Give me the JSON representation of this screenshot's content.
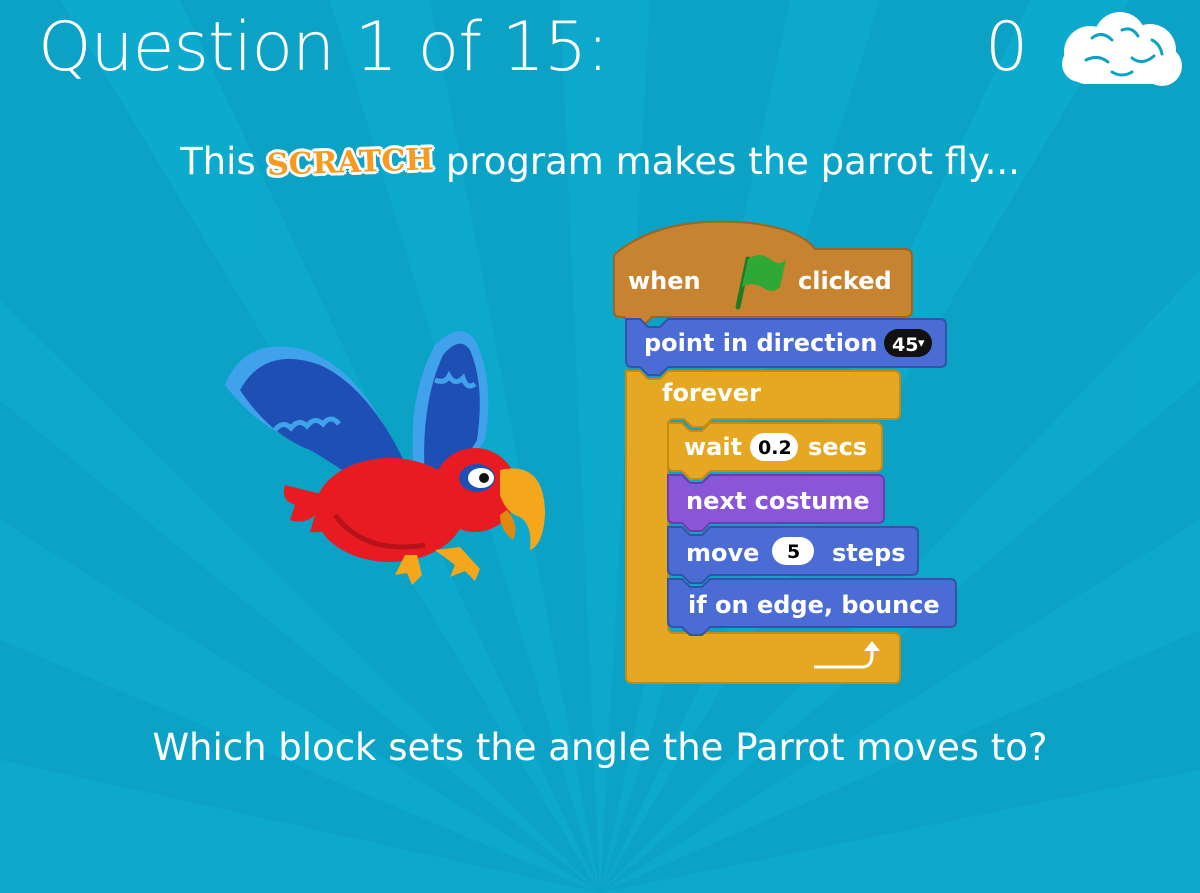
{
  "header": {
    "question_counter": "Question 1 of 15:",
    "score": "0"
  },
  "icons": {
    "score": "brain-cloud-icon",
    "hat_block": "green-flag-icon",
    "loop_end": "loop-arrow-icon"
  },
  "intro": {
    "before": "This",
    "logo": "SCRATCH",
    "after": "program makes the parrot fly..."
  },
  "script": {
    "hat": {
      "before": "when",
      "after": "clicked"
    },
    "point": {
      "label": "point in direction",
      "value": "45",
      "dropdown": "▾"
    },
    "forever": {
      "label": "forever"
    },
    "wait": {
      "before": "wait",
      "value": "0.2",
      "after": "secs"
    },
    "costume": {
      "label": "next costume"
    },
    "move": {
      "before": "move",
      "value": "5",
      "after": "steps"
    },
    "bounce": {
      "label": "if on edge, bounce"
    }
  },
  "question": "Which block sets the angle the Parrot moves to?",
  "colors": {
    "background": "#0ba2c6",
    "events": "#c88330",
    "motion": "#4a6cd4",
    "control": "#e6a822",
    "looks": "#8a55d7",
    "flag": "#2ea836"
  }
}
